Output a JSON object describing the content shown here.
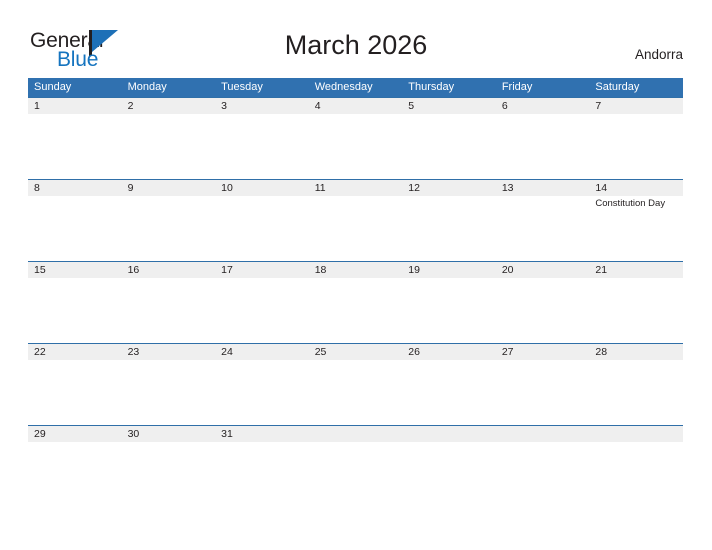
{
  "brand": {
    "name_part1": "General",
    "name_part2": "Blue",
    "logo_icon": "flag-triangle-icon",
    "color_blue": "#1574bf",
    "color_dark": "#231f20"
  },
  "header": {
    "title": "March 2026",
    "country": "Andorra"
  },
  "theme": {
    "header_blue": "#3071b0",
    "row_line_blue": "#2f6fa8",
    "band_gray": "#efefef",
    "text": "#231f20"
  },
  "calendar": {
    "weekdays": [
      "Sunday",
      "Monday",
      "Tuesday",
      "Wednesday",
      "Thursday",
      "Friday",
      "Saturday"
    ],
    "weeks": [
      [
        {
          "day": "1",
          "event": ""
        },
        {
          "day": "2",
          "event": ""
        },
        {
          "day": "3",
          "event": ""
        },
        {
          "day": "4",
          "event": ""
        },
        {
          "day": "5",
          "event": ""
        },
        {
          "day": "6",
          "event": ""
        },
        {
          "day": "7",
          "event": ""
        }
      ],
      [
        {
          "day": "8",
          "event": ""
        },
        {
          "day": "9",
          "event": ""
        },
        {
          "day": "10",
          "event": ""
        },
        {
          "day": "11",
          "event": ""
        },
        {
          "day": "12",
          "event": ""
        },
        {
          "day": "13",
          "event": ""
        },
        {
          "day": "14",
          "event": "Constitution Day"
        }
      ],
      [
        {
          "day": "15",
          "event": ""
        },
        {
          "day": "16",
          "event": ""
        },
        {
          "day": "17",
          "event": ""
        },
        {
          "day": "18",
          "event": ""
        },
        {
          "day": "19",
          "event": ""
        },
        {
          "day": "20",
          "event": ""
        },
        {
          "day": "21",
          "event": ""
        }
      ],
      [
        {
          "day": "22",
          "event": ""
        },
        {
          "day": "23",
          "event": ""
        },
        {
          "day": "24",
          "event": ""
        },
        {
          "day": "25",
          "event": ""
        },
        {
          "day": "26",
          "event": ""
        },
        {
          "day": "27",
          "event": ""
        },
        {
          "day": "28",
          "event": ""
        }
      ],
      [
        {
          "day": "29",
          "event": ""
        },
        {
          "day": "30",
          "event": ""
        },
        {
          "day": "31",
          "event": ""
        },
        {
          "day": "",
          "event": ""
        },
        {
          "day": "",
          "event": ""
        },
        {
          "day": "",
          "event": ""
        },
        {
          "day": "",
          "event": ""
        }
      ]
    ]
  }
}
